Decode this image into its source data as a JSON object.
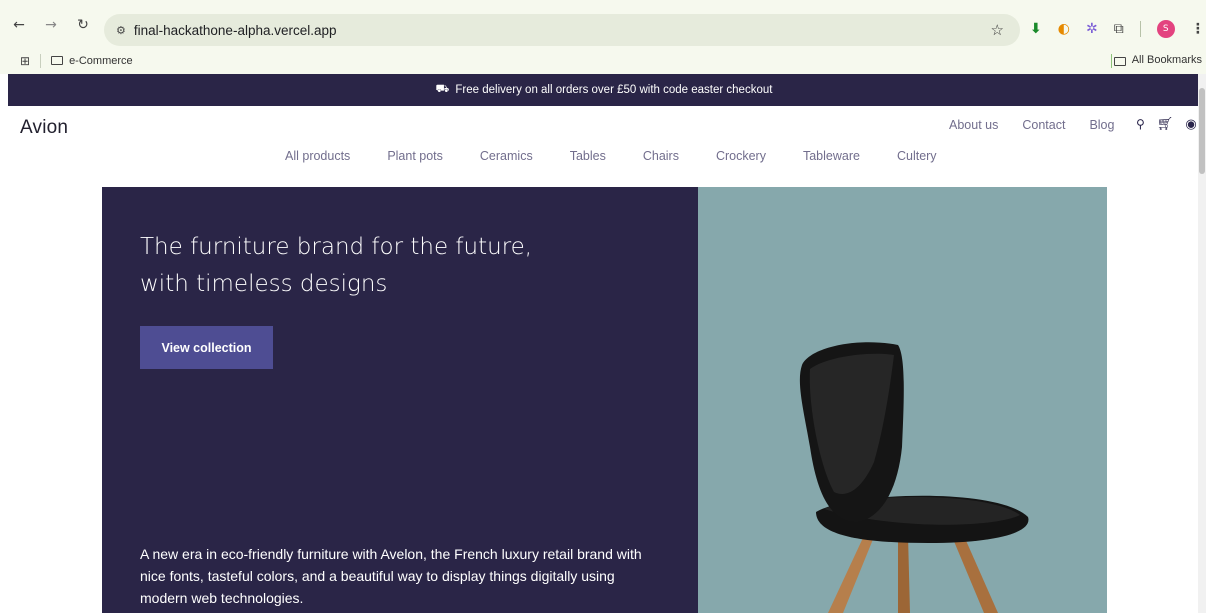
{
  "browser": {
    "url": "final-hackathone-alpha.vercel.app",
    "profile_initial": "S",
    "bookmarks": [
      {
        "label": "e-Commerce"
      }
    ],
    "all_bookmarks_label": "All Bookmarks",
    "icons": {
      "back": "back-arrow-icon",
      "forward": "forward-arrow-icon",
      "reload": "reload-icon",
      "bookmark_star": "star-icon",
      "extensions": "puzzle-icon",
      "menu": "kebab-menu-icon"
    }
  },
  "site": {
    "announcement": "Free delivery on all orders over £50 with code easter checkout",
    "logo": "Avion",
    "top_links": [
      {
        "label": "About us"
      },
      {
        "label": "Contact"
      },
      {
        "label": "Blog"
      }
    ],
    "categories": [
      {
        "label": "All products"
      },
      {
        "label": "Plant pots"
      },
      {
        "label": "Ceramics"
      },
      {
        "label": "Tables"
      },
      {
        "label": "Chairs"
      },
      {
        "label": "Crockery"
      },
      {
        "label": "Tableware"
      },
      {
        "label": "Cultery"
      }
    ],
    "hero": {
      "title": "The furniture brand for the future, with timeless designs",
      "cta_label": "View collection",
      "description": "A new era in eco-friendly furniture with Avelon, the French luxury retail brand with nice fonts, tasteful colors, and a beautiful way to display things digitally using modern web technologies."
    },
    "colors": {
      "primary_dark": "#2a2547",
      "button": "#4e4d93",
      "hero_image_bg": "#86a8ac",
      "link_gray": "#726e8d"
    }
  }
}
